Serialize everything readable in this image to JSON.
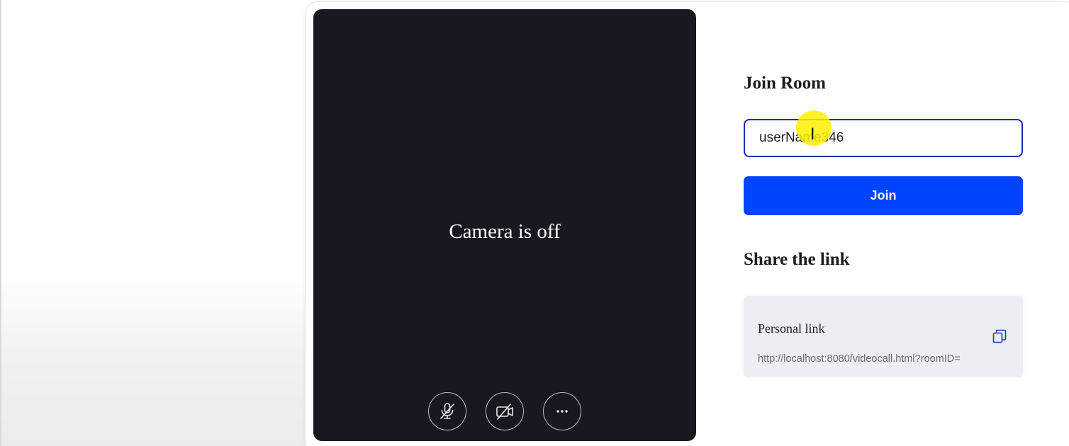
{
  "video": {
    "status_text": "Camera is off",
    "controls": [
      {
        "icon": "mic-off-icon"
      },
      {
        "icon": "camera-off-icon"
      },
      {
        "icon": "more-icon"
      }
    ]
  },
  "join": {
    "heading": "Join Room",
    "username_value": "userName346",
    "button_label": "Join"
  },
  "share": {
    "heading": "Share the link",
    "link_title": "Personal link",
    "link_url": "http://localhost:8080/videocall.html?roomID=",
    "copy_icon": "copy-icon"
  },
  "colors": {
    "accent": "#0044ff",
    "video_bg": "#181820",
    "input_border": "#1a2bb8",
    "cursor_highlight": "#fff000"
  }
}
